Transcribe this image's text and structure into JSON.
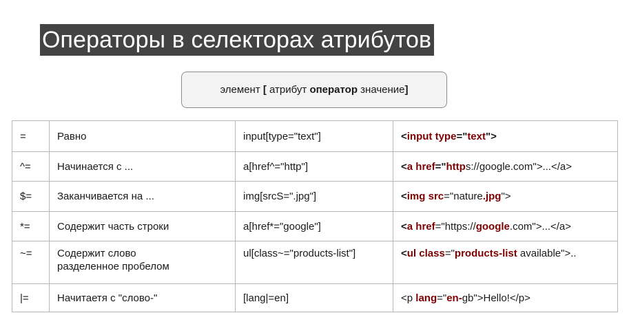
{
  "title": "Операторы в селекторах атрибутов",
  "formula": {
    "before": "элемент ",
    "bracket_open": "[",
    "attr": " атрибут ",
    "operator": "оператор",
    "value": " значение",
    "bracket_close": "]"
  },
  "rows": [
    {
      "operator": "=",
      "description": "Равно",
      "selector": "input[type=\"text\"]",
      "html": [
        {
          "text": "<",
          "style": "punct"
        },
        {
          "text": "input",
          "style": "tag"
        },
        {
          "text": " ",
          "style": "plain"
        },
        {
          "text": "type",
          "style": "tag"
        },
        {
          "text": "=\"",
          "style": "punct"
        },
        {
          "text": "text",
          "style": "val"
        },
        {
          "text": "\">",
          "style": "punct"
        }
      ]
    },
    {
      "operator": "^=",
      "description": "Начинается с ...",
      "selector": "a[href^=\"http\"]",
      "html": [
        {
          "text": "<",
          "style": "punct"
        },
        {
          "text": "a",
          "style": "tag"
        },
        {
          "text": " ",
          "style": "plain"
        },
        {
          "text": "href",
          "style": "tag"
        },
        {
          "text": "=\"",
          "style": "punct"
        },
        {
          "text": "http",
          "style": "val"
        },
        {
          "text": "s://google.com\">...</a>",
          "style": "plain"
        }
      ]
    },
    {
      "operator": "$=",
      "description": "Заканчивается на ...",
      "selector": "img[srcS=\".jpg\"]",
      "html": [
        {
          "text": "<",
          "style": "punct"
        },
        {
          "text": "img",
          "style": "tag"
        },
        {
          "text": " ",
          "style": "plain"
        },
        {
          "text": "src",
          "style": "tag"
        },
        {
          "text": "=\"nature",
          "style": "plain"
        },
        {
          "text": ".jpg",
          "style": "val"
        },
        {
          "text": "\">",
          "style": "plain"
        }
      ]
    },
    {
      "operator": "*=",
      "description": "Содержит часть строки",
      "selector": "a[href*=\"google\"]",
      "html": [
        {
          "text": "<",
          "style": "punct"
        },
        {
          "text": "a",
          "style": "tag"
        },
        {
          "text": " ",
          "style": "plain"
        },
        {
          "text": "href",
          "style": "tag"
        },
        {
          "text": "=\"https://",
          "style": "plain"
        },
        {
          "text": "google",
          "style": "val"
        },
        {
          "text": ".com\">...</a>",
          "style": "plain"
        }
      ]
    },
    {
      "operator": "~=",
      "description": "Содержит слово разделенное пробелом",
      "selector": "ul[class~=\"products-list\"]",
      "html": [
        {
          "text": "<",
          "style": "punct"
        },
        {
          "text": "ul",
          "style": "tag"
        },
        {
          "text": " ",
          "style": "plain"
        },
        {
          "text": "class",
          "style": "tag"
        },
        {
          "text": "=\"",
          "style": "plain"
        },
        {
          "text": "products-list",
          "style": "val"
        },
        {
          "text": " available\">..",
          "style": "plain"
        }
      ]
    },
    {
      "operator": "|=",
      "description": "Начитаетя с \"слово-\"",
      "selector": "[lang|=en]",
      "html": [
        {
          "text": "<p ",
          "style": "plain"
        },
        {
          "text": "lang",
          "style": "tag"
        },
        {
          "text": "=\"",
          "style": "plain"
        },
        {
          "text": "en-",
          "style": "val"
        },
        {
          "text": "gb\">Hello!</p>",
          "style": "plain"
        }
      ]
    }
  ]
}
